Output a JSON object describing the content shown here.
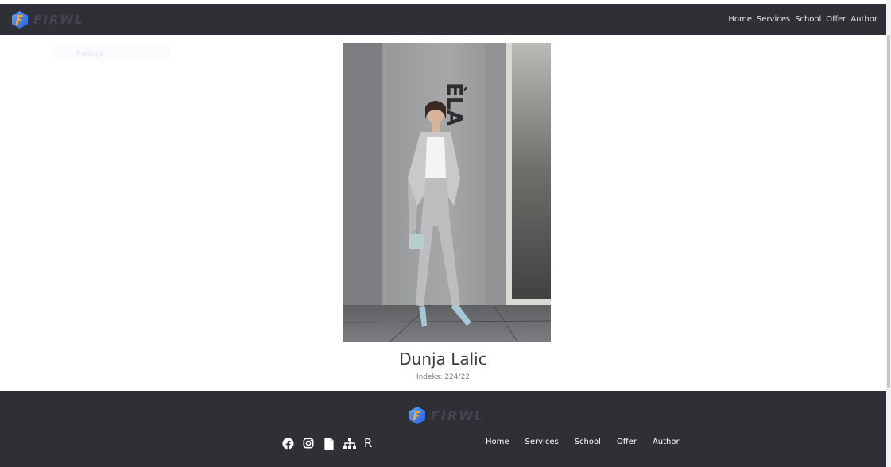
{
  "header": {
    "brand": "FIRWL",
    "nav": [
      "Home",
      "Services",
      "School",
      "Offer",
      "Author"
    ]
  },
  "search": {
    "placeholder": "Pretraga"
  },
  "photo": {
    "sign_letters": "ÈLA"
  },
  "profile": {
    "name": "Dunja Lalic",
    "index": "Indeks: 224/22"
  },
  "footer": {
    "brand": "FIRWL",
    "socials": [
      "facebook-icon",
      "instagram-icon",
      "document-icon",
      "sitemap-icon",
      "R"
    ],
    "nav": [
      "Home",
      "Services",
      "School",
      "Offer",
      "Author"
    ]
  },
  "colors": {
    "bar": "#2f3036",
    "logo_blue": "#3c7bf2",
    "logo_orange": "#f7a536"
  }
}
